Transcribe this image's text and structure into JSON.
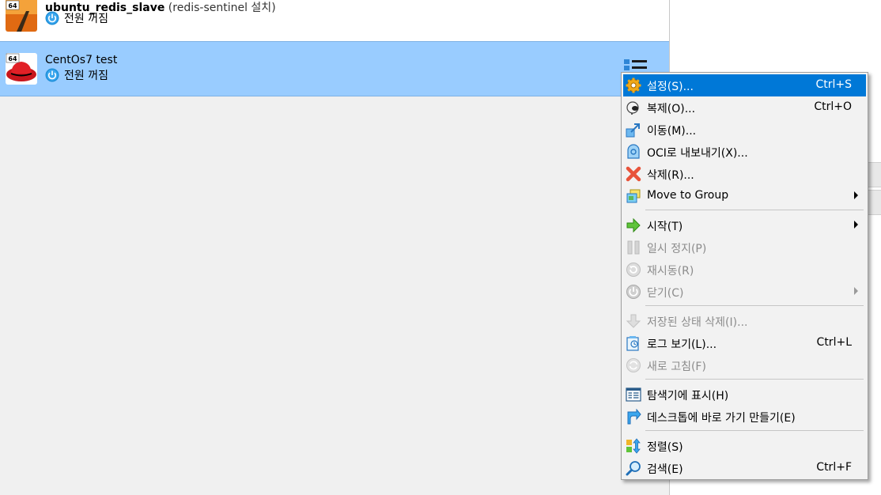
{
  "vms": [
    {
      "name": "ubuntu_redis_slave",
      "subtitle": "(redis-sentinel 설치)",
      "state": "전원 꺼짐",
      "badge": "64"
    },
    {
      "name": "CentOs7 test",
      "subtitle": "",
      "state": "전원 꺼짐",
      "badge": "64"
    }
  ],
  "menu": {
    "settings": {
      "label": "설정(S)...",
      "shortcut": "Ctrl+S"
    },
    "clone": {
      "label": "복제(O)...",
      "shortcut": "Ctrl+O"
    },
    "move": {
      "label": "이동(M)..."
    },
    "export_oci": {
      "label": "OCI로 내보내기(X)..."
    },
    "remove": {
      "label": "삭제(R)..."
    },
    "move_group": {
      "label": "Move to Group"
    },
    "start": {
      "label": "시작(T)"
    },
    "pause": {
      "label": "일시 정지(P)"
    },
    "reset": {
      "label": "재시동(R)"
    },
    "close": {
      "label": "닫기(C)"
    },
    "discard": {
      "label": "저장된 상태 삭제(I)..."
    },
    "logs": {
      "label": "로그 보기(L)...",
      "shortcut": "Ctrl+L"
    },
    "refresh": {
      "label": "새로 고침(F)"
    },
    "explorer": {
      "label": "탐색기에 표시(H)"
    },
    "shortcut": {
      "label": "데스크톱에 바로 가기 만들기(E)"
    },
    "sort": {
      "label": "정렬(S)"
    },
    "search": {
      "label": "검색(E)",
      "shortcut": "Ctrl+F"
    }
  },
  "colors": {
    "highlight": "#0078d7",
    "selected_row": "#99ccff"
  }
}
